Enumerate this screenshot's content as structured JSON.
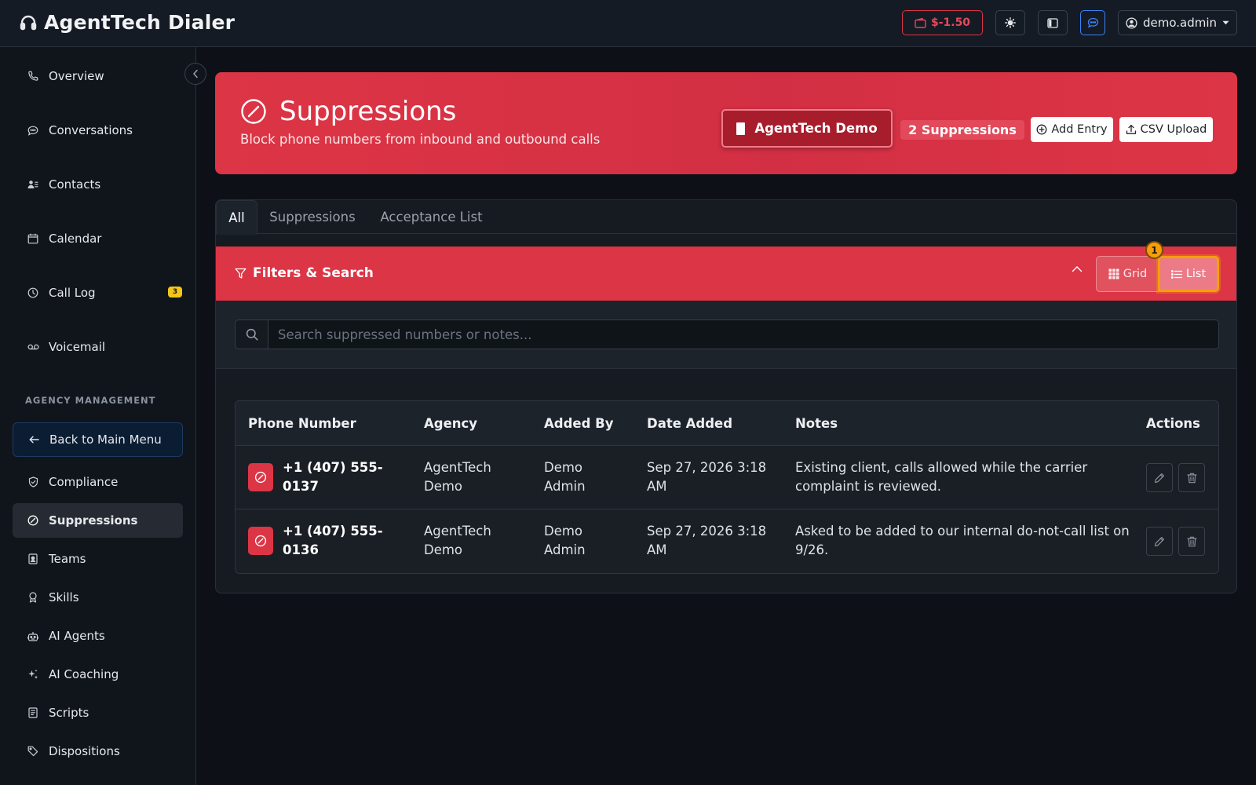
{
  "header": {
    "app_title": "AgentTech Dialer",
    "balance": "$-1.50",
    "username": "demo.admin",
    "icons": [
      "headset-icon",
      "wallet-icon",
      "sun-icon",
      "layout-icon",
      "chat-icon",
      "user-circle-icon",
      "caret-down-icon"
    ]
  },
  "sidebar": {
    "items": [
      {
        "label": "Overview",
        "icon": "phone-icon"
      },
      {
        "label": "Conversations",
        "icon": "chat-bubble-icon"
      },
      {
        "label": "Contacts",
        "icon": "contacts-icon"
      },
      {
        "label": "Calendar",
        "icon": "calendar-icon"
      },
      {
        "label": "Call Log",
        "icon": "clock-icon",
        "badge": "3"
      },
      {
        "label": "Voicemail",
        "icon": "voicemail-icon"
      }
    ],
    "section_label": "AGENCY MANAGEMENT",
    "agency_items": [
      {
        "label": "Back to Main Menu",
        "icon": "arrow-left-icon"
      },
      {
        "label": "Compliance",
        "icon": "shield-icon"
      },
      {
        "label": "Suppressions",
        "icon": "slash-circle-icon",
        "active": true
      },
      {
        "label": "Teams",
        "icon": "badge-icon"
      },
      {
        "label": "Skills",
        "icon": "award-icon"
      },
      {
        "label": "AI Agents",
        "icon": "robot-icon"
      },
      {
        "label": "AI Coaching",
        "icon": "sparkles-icon"
      },
      {
        "label": "Scripts",
        "icon": "document-icon"
      },
      {
        "label": "Dispositions",
        "icon": "tags-icon"
      }
    ]
  },
  "page": {
    "title": "Suppressions",
    "subtitle": "Block phone numbers from inbound and outbound calls",
    "agency_button": "AgentTech Demo",
    "count_label": "2 Suppressions",
    "add_entry": "Add Entry",
    "csv_upload": "CSV Upload",
    "accent_color": "#dc3545"
  },
  "tabs": [
    "All",
    "Suppressions",
    "Acceptance List"
  ],
  "filters": {
    "title": "Filters & Search",
    "grid_label": "Grid",
    "list_label": "List",
    "marker": "1",
    "search_placeholder": "Search suppressed numbers or notes..."
  },
  "table": {
    "columns": [
      "Phone Number",
      "Agency",
      "Added By",
      "Date Added",
      "Notes",
      "Actions"
    ],
    "rows": [
      {
        "phone_line1": "+1 (407) 555-",
        "phone_line2": "0137",
        "agency_line1": "AgentTech",
        "agency_line2": "Demo",
        "added_by_line1": "Demo",
        "added_by_line2": "Admin",
        "date_line1": "Sep 27, 2026 3:18",
        "date_line2": "AM",
        "notes_line1": "Existing client, calls allowed while the carrier",
        "notes_line2": "complaint is reviewed."
      },
      {
        "phone_line1": "+1 (407) 555-",
        "phone_line2": "0136",
        "agency_line1": "AgentTech",
        "agency_line2": "Demo",
        "added_by_line1": "Demo",
        "added_by_line2": "Admin",
        "date_line1": "Sep 27, 2026 3:18",
        "date_line2": "AM",
        "notes_line1": "Asked to be added to our internal do-not-call list on",
        "notes_line2": "9/26."
      }
    ]
  }
}
